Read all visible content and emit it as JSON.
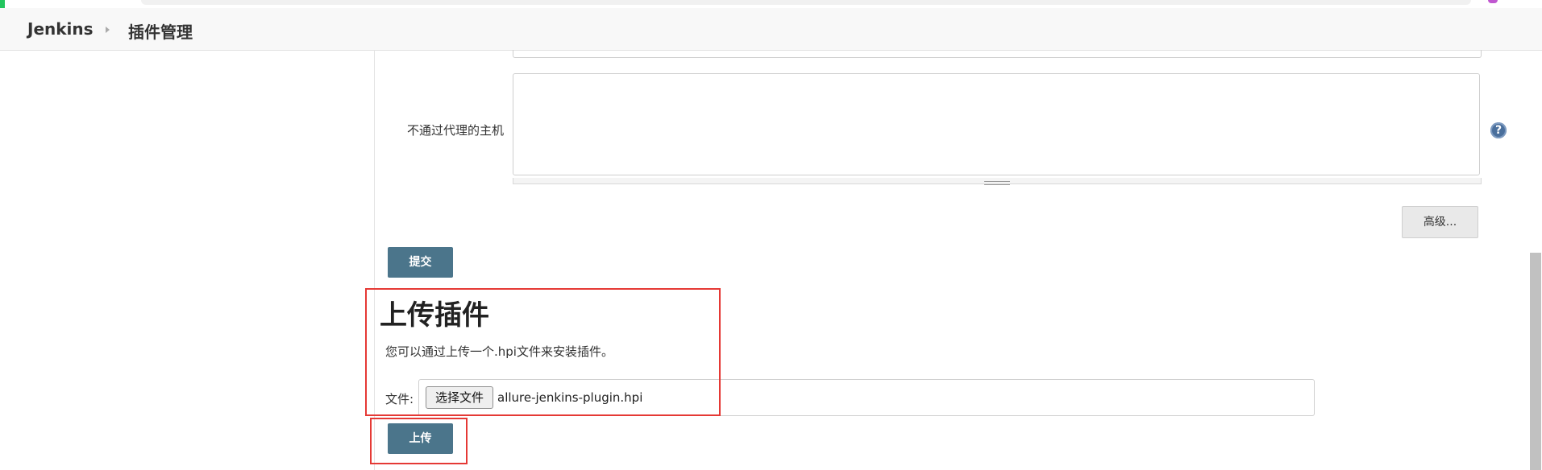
{
  "breadcrumb": {
    "root": "Jenkins",
    "current": "插件管理"
  },
  "proxy": {
    "no_proxy_hosts_label": "不通过代理的主机",
    "no_proxy_hosts_value": "",
    "help_icon_glyph": "?"
  },
  "buttons": {
    "advanced": "高级...",
    "submit": "提交",
    "upload": "上传"
  },
  "upload_plugin": {
    "title": "上传插件",
    "description": "您可以通过上传一个.hpi文件来安装插件。",
    "file_label": "文件:",
    "choose_file_button": "选择文件",
    "selected_file": "allure-jenkins-plugin.hpi"
  },
  "colors": {
    "primary_button": "#4b758b",
    "highlight_box": "#e53935",
    "help_icon": "#4a6f9c"
  }
}
